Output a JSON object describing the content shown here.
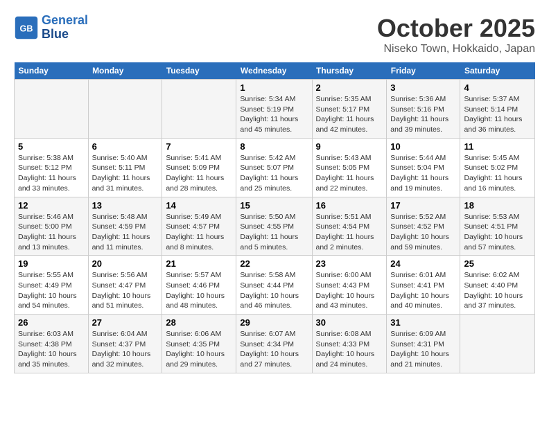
{
  "header": {
    "logo_line1": "General",
    "logo_line2": "Blue",
    "month": "October 2025",
    "location": "Niseko Town, Hokkaido, Japan"
  },
  "weekdays": [
    "Sunday",
    "Monday",
    "Tuesday",
    "Wednesday",
    "Thursday",
    "Friday",
    "Saturday"
  ],
  "weeks": [
    [
      {
        "day": "",
        "info": ""
      },
      {
        "day": "",
        "info": ""
      },
      {
        "day": "",
        "info": ""
      },
      {
        "day": "1",
        "info": "Sunrise: 5:34 AM\nSunset: 5:19 PM\nDaylight: 11 hours\nand 45 minutes."
      },
      {
        "day": "2",
        "info": "Sunrise: 5:35 AM\nSunset: 5:17 PM\nDaylight: 11 hours\nand 42 minutes."
      },
      {
        "day": "3",
        "info": "Sunrise: 5:36 AM\nSunset: 5:16 PM\nDaylight: 11 hours\nand 39 minutes."
      },
      {
        "day": "4",
        "info": "Sunrise: 5:37 AM\nSunset: 5:14 PM\nDaylight: 11 hours\nand 36 minutes."
      }
    ],
    [
      {
        "day": "5",
        "info": "Sunrise: 5:38 AM\nSunset: 5:12 PM\nDaylight: 11 hours\nand 33 minutes."
      },
      {
        "day": "6",
        "info": "Sunrise: 5:40 AM\nSunset: 5:11 PM\nDaylight: 11 hours\nand 31 minutes."
      },
      {
        "day": "7",
        "info": "Sunrise: 5:41 AM\nSunset: 5:09 PM\nDaylight: 11 hours\nand 28 minutes."
      },
      {
        "day": "8",
        "info": "Sunrise: 5:42 AM\nSunset: 5:07 PM\nDaylight: 11 hours\nand 25 minutes."
      },
      {
        "day": "9",
        "info": "Sunrise: 5:43 AM\nSunset: 5:05 PM\nDaylight: 11 hours\nand 22 minutes."
      },
      {
        "day": "10",
        "info": "Sunrise: 5:44 AM\nSunset: 5:04 PM\nDaylight: 11 hours\nand 19 minutes."
      },
      {
        "day": "11",
        "info": "Sunrise: 5:45 AM\nSunset: 5:02 PM\nDaylight: 11 hours\nand 16 minutes."
      }
    ],
    [
      {
        "day": "12",
        "info": "Sunrise: 5:46 AM\nSunset: 5:00 PM\nDaylight: 11 hours\nand 13 minutes."
      },
      {
        "day": "13",
        "info": "Sunrise: 5:48 AM\nSunset: 4:59 PM\nDaylight: 11 hours\nand 11 minutes."
      },
      {
        "day": "14",
        "info": "Sunrise: 5:49 AM\nSunset: 4:57 PM\nDaylight: 11 hours\nand 8 minutes."
      },
      {
        "day": "15",
        "info": "Sunrise: 5:50 AM\nSunset: 4:55 PM\nDaylight: 11 hours\nand 5 minutes."
      },
      {
        "day": "16",
        "info": "Sunrise: 5:51 AM\nSunset: 4:54 PM\nDaylight: 11 hours\nand 2 minutes."
      },
      {
        "day": "17",
        "info": "Sunrise: 5:52 AM\nSunset: 4:52 PM\nDaylight: 10 hours\nand 59 minutes."
      },
      {
        "day": "18",
        "info": "Sunrise: 5:53 AM\nSunset: 4:51 PM\nDaylight: 10 hours\nand 57 minutes."
      }
    ],
    [
      {
        "day": "19",
        "info": "Sunrise: 5:55 AM\nSunset: 4:49 PM\nDaylight: 10 hours\nand 54 minutes."
      },
      {
        "day": "20",
        "info": "Sunrise: 5:56 AM\nSunset: 4:47 PM\nDaylight: 10 hours\nand 51 minutes."
      },
      {
        "day": "21",
        "info": "Sunrise: 5:57 AM\nSunset: 4:46 PM\nDaylight: 10 hours\nand 48 minutes."
      },
      {
        "day": "22",
        "info": "Sunrise: 5:58 AM\nSunset: 4:44 PM\nDaylight: 10 hours\nand 46 minutes."
      },
      {
        "day": "23",
        "info": "Sunrise: 6:00 AM\nSunset: 4:43 PM\nDaylight: 10 hours\nand 43 minutes."
      },
      {
        "day": "24",
        "info": "Sunrise: 6:01 AM\nSunset: 4:41 PM\nDaylight: 10 hours\nand 40 minutes."
      },
      {
        "day": "25",
        "info": "Sunrise: 6:02 AM\nSunset: 4:40 PM\nDaylight: 10 hours\nand 37 minutes."
      }
    ],
    [
      {
        "day": "26",
        "info": "Sunrise: 6:03 AM\nSunset: 4:38 PM\nDaylight: 10 hours\nand 35 minutes."
      },
      {
        "day": "27",
        "info": "Sunrise: 6:04 AM\nSunset: 4:37 PM\nDaylight: 10 hours\nand 32 minutes."
      },
      {
        "day": "28",
        "info": "Sunrise: 6:06 AM\nSunset: 4:35 PM\nDaylight: 10 hours\nand 29 minutes."
      },
      {
        "day": "29",
        "info": "Sunrise: 6:07 AM\nSunset: 4:34 PM\nDaylight: 10 hours\nand 27 minutes."
      },
      {
        "day": "30",
        "info": "Sunrise: 6:08 AM\nSunset: 4:33 PM\nDaylight: 10 hours\nand 24 minutes."
      },
      {
        "day": "31",
        "info": "Sunrise: 6:09 AM\nSunset: 4:31 PM\nDaylight: 10 hours\nand 21 minutes."
      },
      {
        "day": "",
        "info": ""
      }
    ]
  ]
}
